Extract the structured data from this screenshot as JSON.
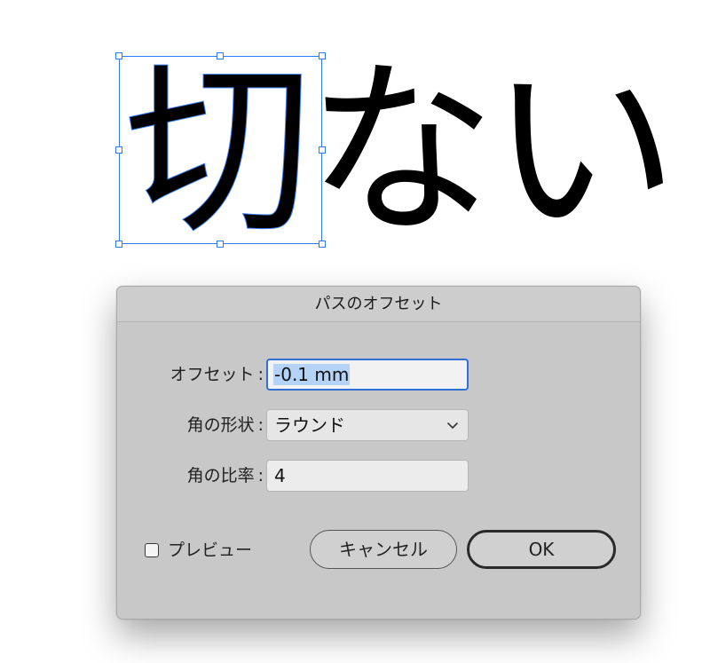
{
  "canvas": {
    "selected_glyph": "切",
    "other_glyphs": "ない",
    "selection_color": "#2f7bf5"
  },
  "dialog": {
    "title": "パスのオフセット",
    "offset": {
      "label": "オフセット",
      "value": "-0.1 mm"
    },
    "joins": {
      "label": "角の形状",
      "value": "ラウンド",
      "icon": "chevron-down-icon"
    },
    "miter_limit": {
      "label": "角の比率",
      "value": "4"
    },
    "preview": {
      "label": "プレビュー",
      "checked": false
    },
    "buttons": {
      "cancel": "キャンセル",
      "ok": "OK"
    }
  }
}
